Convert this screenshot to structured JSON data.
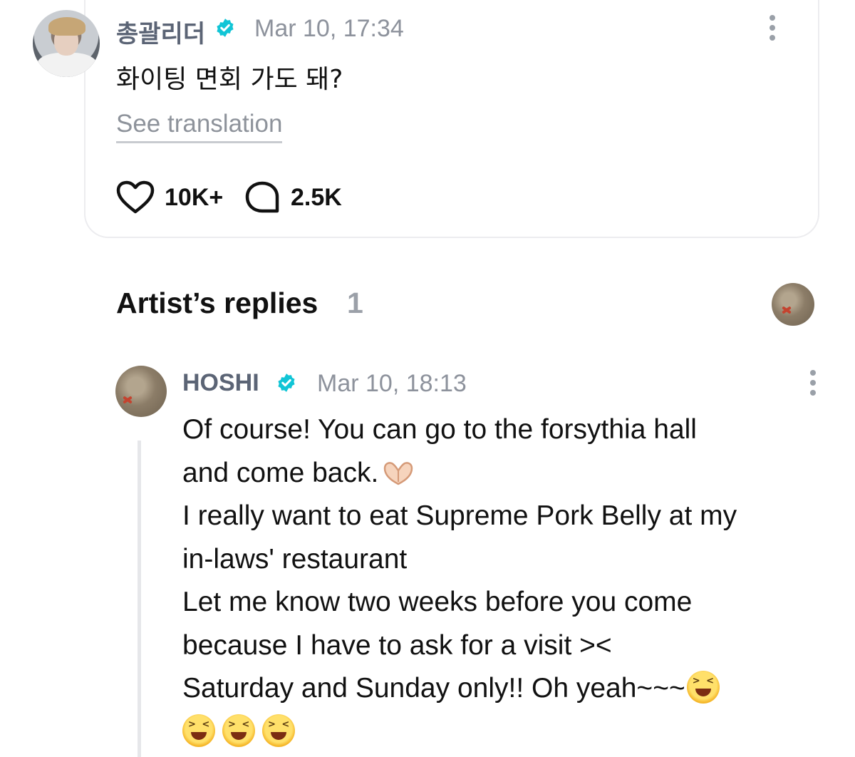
{
  "post": {
    "author": "총괄리더",
    "timestamp": "Mar 10, 17:34",
    "text": "화이팅 면회 가도 돼?",
    "translate_label": "See translation",
    "likes": "10K+",
    "comments": "2.5K"
  },
  "replies_section": {
    "title": "Artist’s replies",
    "count": "1"
  },
  "reply": {
    "author": "HOSHI",
    "timestamp": "Mar 10, 18:13",
    "lines": [
      "Of course! You can go to the forsythia hall",
      "and come back.",
      "I really want to eat Supreme Pork Belly at my",
      "in-laws' restaurant",
      "Let me know two weeks before you come",
      "because I have to ask for a visit ><",
      "Saturday and Sunday only!! Oh yeah~~~"
    ]
  },
  "colors": {
    "verified": "#11c5d6",
    "name": "#5b6475",
    "muted": "#8d929c"
  },
  "icons": [
    "verified-badge-icon",
    "more-options-icon",
    "heart-icon",
    "comment-icon",
    "heart-hands-emoji",
    "laughing-emoji"
  ]
}
